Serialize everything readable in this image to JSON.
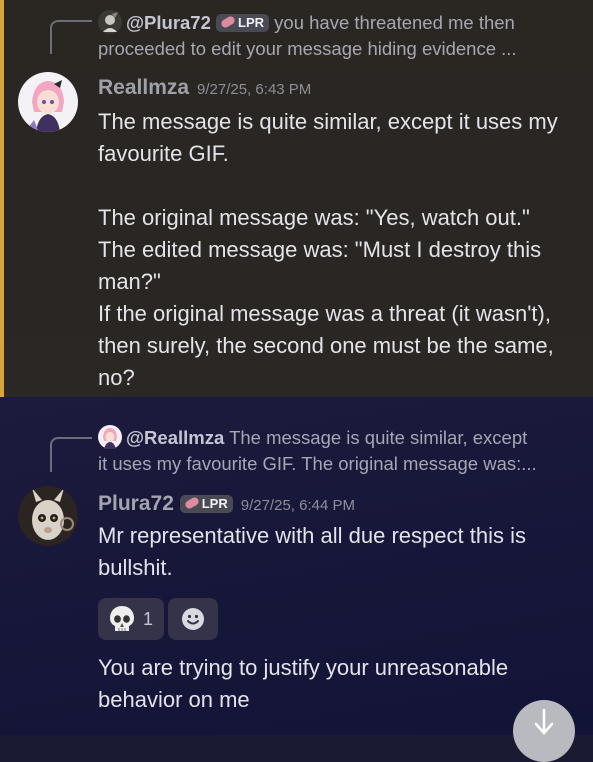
{
  "message1": {
    "reply": {
      "username": "@Plura72",
      "badge": "LPR",
      "preview_line1": "you have threatened me then",
      "preview_line2": "proceeded to edit your message hiding evidence ..."
    },
    "author": "Reallmza",
    "timestamp": "9/27/25, 6:43 PM",
    "body": "The message is quite similar, except it uses my\nfavourite GIF.\n\nThe original message was: \"Yes, watch out.\"\nThe edited message was: \"Must I destroy this\nman?\"\nIf the original message was a threat (it wasn't),\nthen surely, the second one must be the same,\nno?",
    "accent_color": "#d9a43a"
  },
  "message2": {
    "reply": {
      "username": "@Reallmza",
      "preview_line1": "The message is quite similar, except",
      "preview_line2": "it uses my favourite GIF.  The original message was:..."
    },
    "author": "Plura72",
    "badge": "LPR",
    "timestamp": "9/27/25, 6:44 PM",
    "body": "Mr representative with all due respect this is\nbullshit.",
    "reactions": [
      {
        "icon": "skull-emoji-icon",
        "count": "1"
      },
      {
        "icon": "add-reaction-icon"
      }
    ],
    "followup": "You are trying to justify your unreasonable\nbehavior on me"
  },
  "controls": {
    "jump_icon": "arrow-down-icon"
  }
}
